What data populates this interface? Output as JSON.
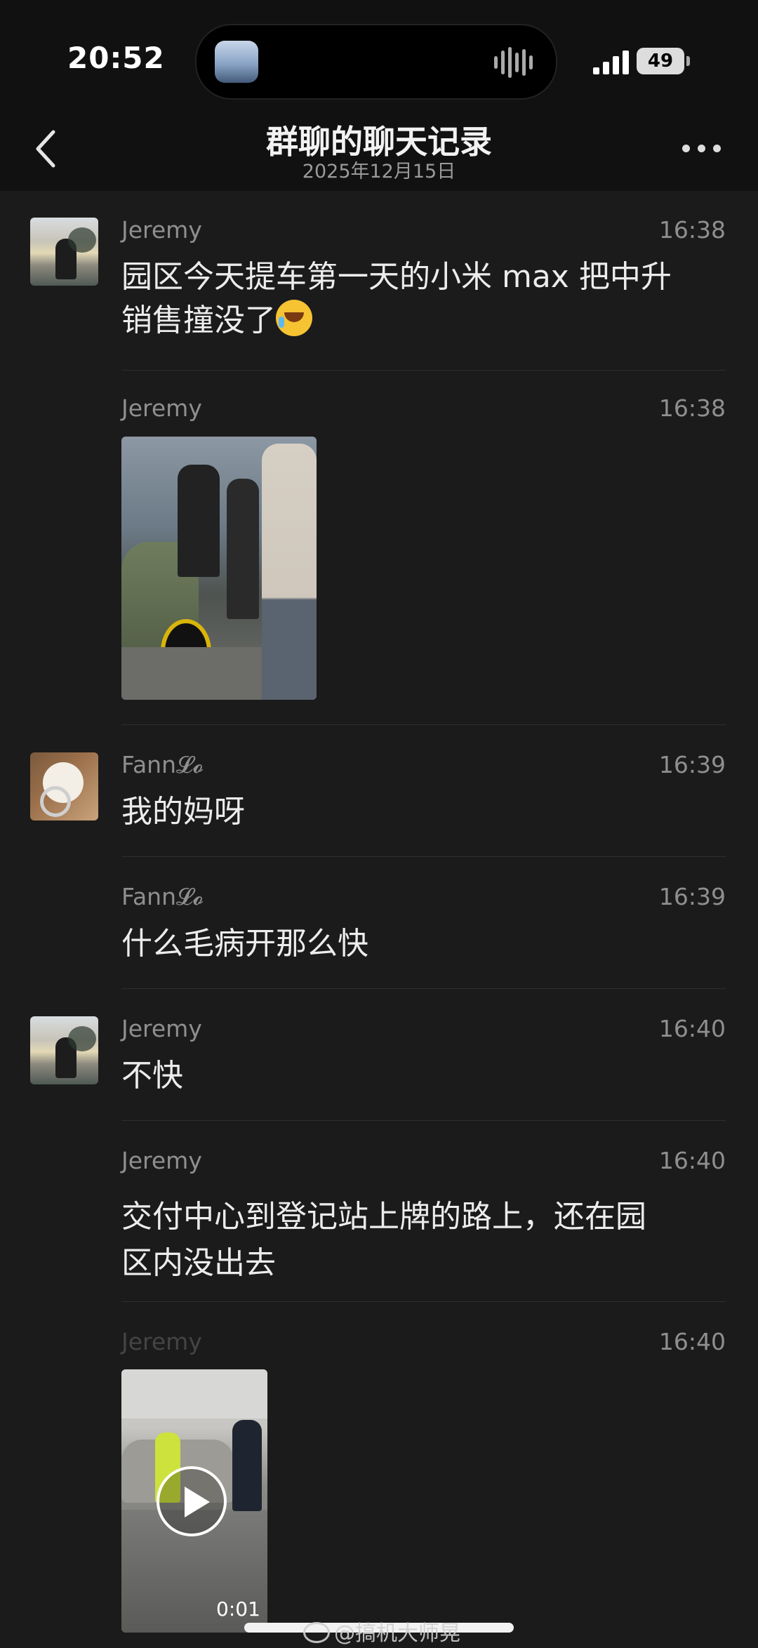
{
  "status_bar": {
    "time": "20:52",
    "battery": "49"
  },
  "header": {
    "title": "群聊的聊天记录",
    "subtitle": "2025年12月15日"
  },
  "messages": [
    {
      "sender": "Jeremy",
      "time": "16:38",
      "line1": "园区今天提车第一天的小米 max 把中升",
      "line2": "销售撞没了"
    },
    {
      "sender": "Jeremy",
      "time": "16:38"
    },
    {
      "sender": "Fann𝓛𝓸",
      "time": "16:39",
      "text": "我的妈呀"
    },
    {
      "sender": "Fann𝓛𝓸",
      "time": "16:39",
      "text": "什么毛病开那么快"
    },
    {
      "sender": "Jeremy",
      "time": "16:40",
      "text": "不快"
    },
    {
      "sender": "Jeremy",
      "time": "16:40",
      "line1": "交付中心到登记站上牌的路上，还在园",
      "line2": "区内没出去"
    },
    {
      "sender": "Jeremy",
      "time": "16:40",
      "video_duration": "0:01"
    }
  ],
  "watermark": "@搞机大师晃",
  "icons": [
    "back-chevron-icon",
    "more-dots-icon",
    "play-icon",
    "signal-icon",
    "battery-icon",
    "laugh-cry-emoji-icon"
  ]
}
